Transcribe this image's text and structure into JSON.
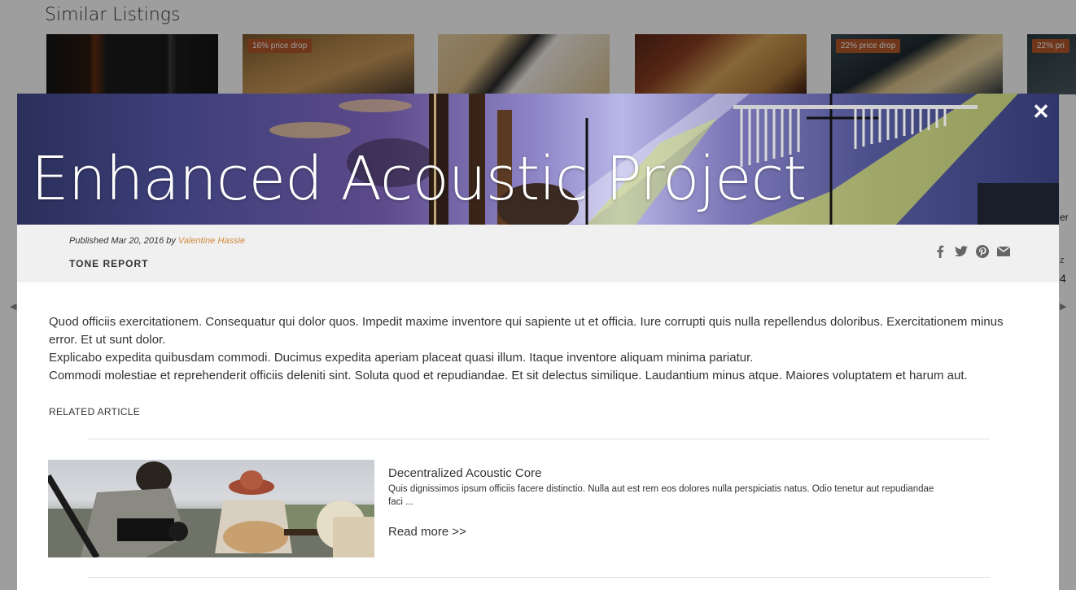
{
  "background": {
    "section_title": "Similar Listings",
    "listings": [
      {
        "badge": ""
      },
      {
        "badge": "16% price drop"
      },
      {
        "badge": ""
      },
      {
        "badge": ""
      },
      {
        "badge": "22% price drop"
      },
      {
        "badge": "22% pri"
      }
    ],
    "edge_fragments": [
      "er",
      "z",
      "4"
    ]
  },
  "modal": {
    "close_label": "✕",
    "hero_title": "Enhanced Acoustic Project",
    "meta": {
      "published_prefix": "Published Mar 20, 2016 by ",
      "author": "Valentine Hassie",
      "category": "TONE REPORT"
    },
    "share_icons": [
      "facebook-icon",
      "twitter-icon",
      "pinterest-icon",
      "email-icon"
    ],
    "body": {
      "p1": "Quod officiis exercitationem. Consequatur qui dolor quos. Impedit maxime inventore qui sapiente ut et officia. Iure corrupti quis nulla repellendus doloribus. Exercitationem minus error. Et ut sunt dolor.",
      "p2": "Explicabo expedita quibusdam commodi. Ducimus expedita aperiam placeat quasi illum. Itaque inventore aliquam minima pariatur.",
      "p3": "Commodi molestiae et reprehenderit officiis deleniti sint. Soluta quod et repudiandae. Et sit delectus similique. Laudantium minus atque. Maiores voluptatem et harum aut."
    },
    "related": {
      "label": "RELATED ARTICLE",
      "title": "Decentralized Acoustic Core",
      "excerpt": "Quis dignissimos ipsum officiis facere distinctio. Nulla aut est rem eos dolores nulla perspiciatis natus. Odio tenetur aut repudiandae faci ...",
      "read_more": "Read more >>"
    }
  },
  "colors": {
    "author_link": "#d08a3a",
    "badge": "#b4572b",
    "meta_bar": "#f0f0f0"
  }
}
